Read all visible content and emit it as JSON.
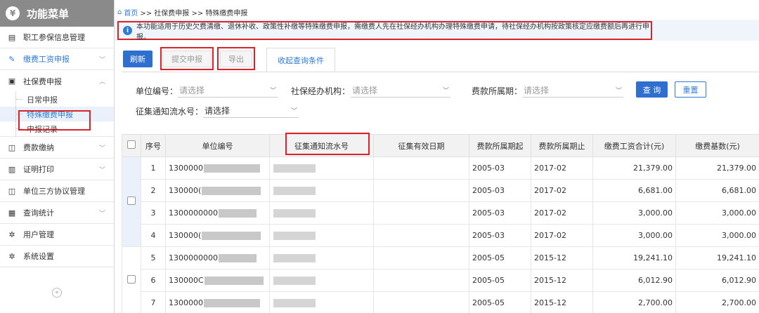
{
  "sidebar": {
    "title": "功能菜单",
    "items": [
      {
        "label": "职工参保信息管理",
        "icon": "id-card-icon"
      },
      {
        "label": "缴费工资申报",
        "icon": "edit-icon"
      },
      {
        "label": "社保费申报",
        "icon": "document-icon"
      },
      {
        "label": "费款缴纳",
        "icon": "folder-icon"
      },
      {
        "label": "证明打印",
        "icon": "print-icon"
      },
      {
        "label": "单位三方协议管理",
        "icon": "folder-icon"
      },
      {
        "label": "查询统计",
        "icon": "chart-icon"
      },
      {
        "label": "用户管理",
        "icon": "gear-icon"
      },
      {
        "label": "系统设置",
        "icon": "gear-icon"
      }
    ],
    "subitems": [
      "日常申报",
      "特殊缴费申报",
      "申报记录"
    ]
  },
  "breadcrumb": {
    "home": "首页",
    "path": ">> 社保费申报 >> 特殊缴费申报"
  },
  "notice": "本功能适用于历史欠费清缴、退休补收、政策性补缴等特殊缴费申报，需缴费人先在社保经办机构办理特殊缴费申请，待社保经办机构按政策核定应缴费额后再进行申报。",
  "toolbar": {
    "refresh": "刷新",
    "submit": "提交申报",
    "export": "导出",
    "collapse_tab": "收起查询条件"
  },
  "form": {
    "unit_label": "单位编号：",
    "agency_label": "社保经办机构：",
    "period_label": "费款所属期：",
    "serial_label": "征集通知流水号：",
    "placeholder": "请选择",
    "query": "查 询",
    "reset": "重置"
  },
  "table": {
    "headers": [
      "序号",
      "单位编号",
      "征集通知流水号",
      "征集有效日期",
      "费款所属期起",
      "费款所属期止",
      "缴费工资合计(元)",
      "缴费基数(元)"
    ],
    "rows": [
      {
        "no": "1",
        "unit": "1300000",
        "start": "2005-03",
        "end": "2017-02",
        "wage": "21,379.00",
        "base": "21,379.00"
      },
      {
        "no": "2",
        "unit": "130000(",
        "start": "2005-03",
        "end": "2017-02",
        "wage": "6,681.00",
        "base": "6,681.00"
      },
      {
        "no": "3",
        "unit": "1300000000",
        "start": "2005-03",
        "end": "2017-02",
        "wage": "3,000.00",
        "base": "3,000.00"
      },
      {
        "no": "4",
        "unit": "130000(",
        "start": "2005-03",
        "end": "2017-02",
        "wage": "3,000.00",
        "base": "3,000.00"
      },
      {
        "no": "5",
        "unit": "1300000000",
        "start": "2005-05",
        "end": "2015-12",
        "wage": "19,241.10",
        "base": "19,241.10"
      },
      {
        "no": "6",
        "unit": "130000C",
        "start": "2005-05",
        "end": "2015-12",
        "wage": "6,012.90",
        "base": "6,012.90"
      },
      {
        "no": "7",
        "unit": "1300000",
        "start": "2005-05",
        "end": "2015-12",
        "wage": "2,700.00",
        "base": "2,700.00"
      }
    ]
  }
}
